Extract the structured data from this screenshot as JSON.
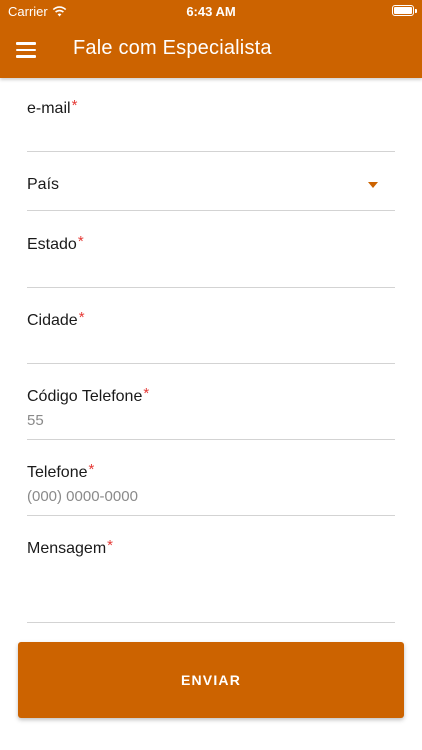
{
  "status_bar": {
    "carrier": "Carrier",
    "time": "6:43 AM"
  },
  "app_bar": {
    "title": "Fale com Especialista",
    "menu_icon": "hamburger-menu-icon",
    "color": "#CC6300"
  },
  "form": {
    "required_mark": "*",
    "email": {
      "label": "e-mail",
      "value": ""
    },
    "pais": {
      "label": "País",
      "icon": "dropdown-caret-icon"
    },
    "estado": {
      "label": "Estado",
      "value": ""
    },
    "cidade": {
      "label": "Cidade",
      "value": ""
    },
    "codigo_telefone": {
      "label": "Código Telefone",
      "value": "55"
    },
    "telefone": {
      "label": "Telefone",
      "placeholder": "(000) 0000-0000"
    },
    "mensagem": {
      "label": "Mensagem",
      "value": ""
    }
  },
  "submit": {
    "label": "ENVIAR"
  },
  "colors": {
    "accent": "#CC6300",
    "required": "#E53935",
    "divider": "#D3D3D3"
  }
}
